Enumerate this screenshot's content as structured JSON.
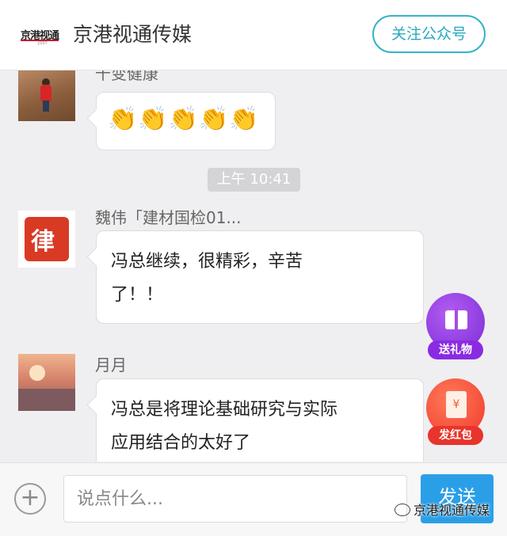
{
  "header": {
    "logo_text": "京港视通",
    "logo_sub": "JOSY",
    "title": "京港视通传媒",
    "follow_button": "关注公众号"
  },
  "messages": [
    {
      "sender": "千变健康",
      "text": "👏👏👏👏👏",
      "type": "emoji"
    },
    {
      "timestamp": "上午 10:41"
    },
    {
      "sender": "魏伟「建材国检01...",
      "avatar_char": "律",
      "lines": [
        "冯总继续，很精彩，辛苦",
        "了！！"
      ]
    },
    {
      "sender": "月月",
      "lines": [
        "冯总是将理论基础研究与实际",
        "应用结合的太好了"
      ]
    }
  ],
  "floating": {
    "gift_label": "送礼物",
    "gift_icon": "gift-icon",
    "redpacket_label": "发红包",
    "redpacket_symbol": "¥",
    "redpacket_icon": "red-envelope-icon"
  },
  "input_bar": {
    "plus_icon": "plus-icon",
    "placeholder": "说点什么...",
    "send_label": "发送",
    "watermark": "京港视通传媒"
  },
  "colors": {
    "follow_border": "#35b3c8",
    "send_button": "#2a9fe8",
    "gift_purple": "#8a2be2",
    "redpacket_red": "#e8342b"
  }
}
